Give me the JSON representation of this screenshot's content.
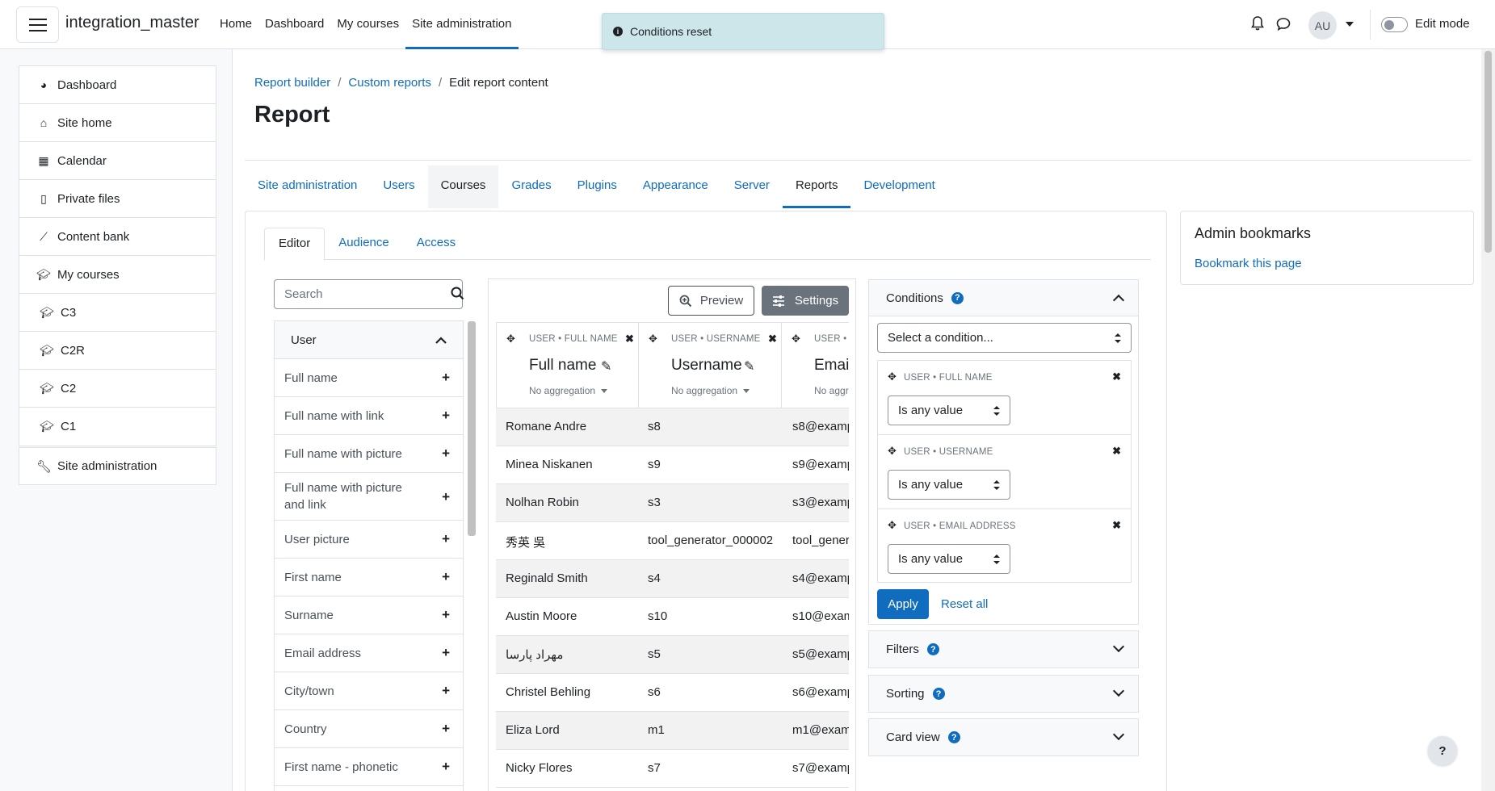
{
  "navbar": {
    "site_name": "integration_master",
    "links": [
      "Home",
      "Dashboard",
      "My courses",
      "Site administration"
    ],
    "avatar_initials": "AU",
    "edit_mode_label": "Edit mode"
  },
  "toast": {
    "message": "Conditions reset"
  },
  "drawer": {
    "items": [
      {
        "label": "Dashboard",
        "icon": "dashboard-icon"
      },
      {
        "label": "Site home",
        "icon": "home-icon"
      },
      {
        "label": "Calendar",
        "icon": "calendar-icon"
      },
      {
        "label": "Private files",
        "icon": "file-icon"
      },
      {
        "label": "Content bank",
        "icon": "brush-icon"
      },
      {
        "label": "My courses",
        "icon": "graduation-cap-icon"
      },
      {
        "label": "C3",
        "icon": "graduation-cap-icon"
      },
      {
        "label": "C2R",
        "icon": "graduation-cap-icon"
      },
      {
        "label": "C2",
        "icon": "graduation-cap-icon"
      },
      {
        "label": "C1",
        "icon": "graduation-cap-icon"
      }
    ],
    "admin": {
      "label": "Site administration",
      "icon": "wrench-icon"
    }
  },
  "breadcrumb": [
    "Report builder",
    "Custom reports",
    "Edit report content"
  ],
  "page_title": "Report",
  "secondary_nav": [
    "Site administration",
    "Users",
    "Courses",
    "Grades",
    "Plugins",
    "Appearance",
    "Server",
    "Reports",
    "Development"
  ],
  "tabs": [
    "Editor",
    "Audience",
    "Access"
  ],
  "search": {
    "placeholder": "Search"
  },
  "columns_panel": {
    "header": "User",
    "items": [
      "Full name",
      "Full name with link",
      "Full name with picture",
      "Full name with picture and link",
      "User picture",
      "First name",
      "Surname",
      "Email address",
      "City/town",
      "Country",
      "First name - phonetic"
    ]
  },
  "report": {
    "preview_label": "Preview",
    "settings_label": "Settings",
    "headers": [
      {
        "meta": "USER • FULL NAME",
        "name": "Full name",
        "agg": "No aggregation"
      },
      {
        "meta": "USER • USERNAME",
        "name": "Username",
        "agg": "No aggregation"
      },
      {
        "meta": "USER •",
        "name": "Emai",
        "agg": "No aggr"
      }
    ],
    "rows": [
      [
        "Romane Andre",
        "s8",
        "s8@examp"
      ],
      [
        "Minea Niskanen",
        "s9",
        "s9@examp"
      ],
      [
        "Nolhan Robin",
        "s3",
        "s3@examp"
      ],
      [
        "秀英 吳",
        "tool_generator_000002",
        "tool_gener"
      ],
      [
        "Reginald Smith",
        "s4",
        "s4@examp"
      ],
      [
        "Austin Moore",
        "s10",
        "s10@exam"
      ],
      [
        "مهراد پارسا",
        "s5",
        "s5@examp"
      ],
      [
        "Christel Behling",
        "s6",
        "s6@examp"
      ],
      [
        "Eliza Lord",
        "m1",
        "m1@exam"
      ],
      [
        "Nicky Flores",
        "s7",
        "s7@examp"
      ]
    ]
  },
  "conditions": {
    "title": "Conditions",
    "select_placeholder": "Select a condition...",
    "items": [
      {
        "meta": "USER • FULL NAME",
        "value": "Is any value"
      },
      {
        "meta": "USER • USERNAME",
        "value": "Is any value"
      },
      {
        "meta": "USER • EMAIL ADDRESS",
        "value": "Is any value"
      }
    ],
    "apply_label": "Apply",
    "reset_label": "Reset all"
  },
  "accordions": [
    "Filters",
    "Sorting",
    "Card view"
  ],
  "bookmarks": {
    "title": "Admin bookmarks",
    "link": "Bookmark this page"
  },
  "help_button": "?"
}
